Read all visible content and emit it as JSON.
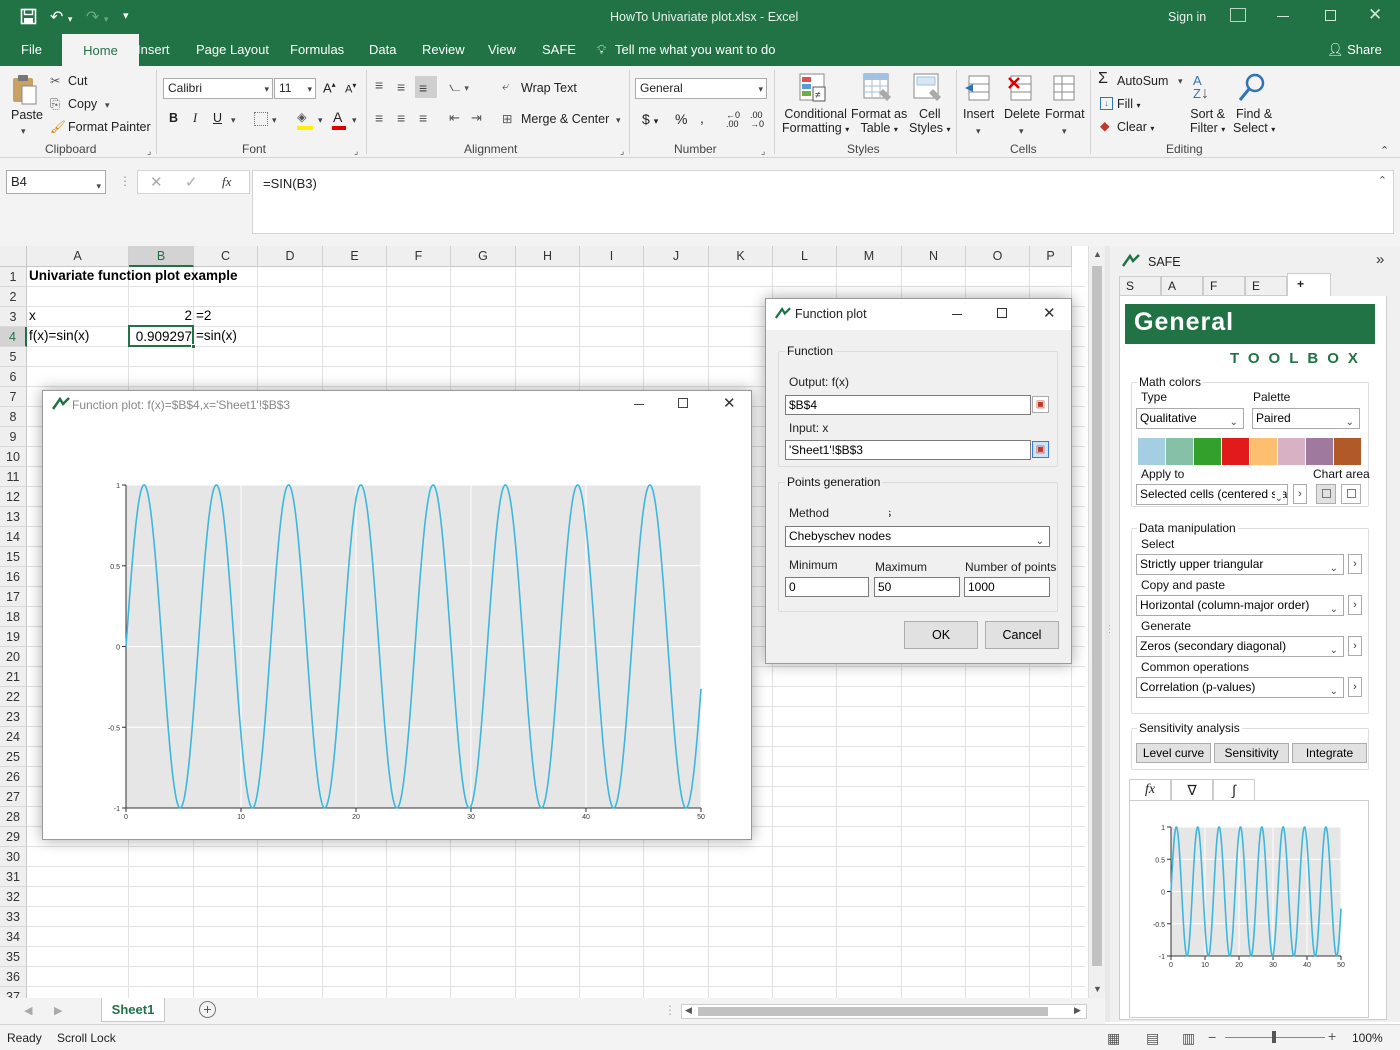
{
  "window": {
    "title": "HowTo Univariate plot.xlsx - Excel",
    "sign_in": "Sign in"
  },
  "tabs": [
    "File",
    "Home",
    "Insert",
    "Page Layout",
    "Formulas",
    "Data",
    "Review",
    "View",
    "SAFE"
  ],
  "tell_me": "Tell me what you want to do",
  "share": "Share",
  "ribbon": {
    "paste": "Paste",
    "cut": "Cut",
    "copy": "Copy",
    "format_painter": "Format Painter",
    "clipboard": "Clipboard",
    "font_name": "Calibri",
    "font_size": "11",
    "font": "Font",
    "wrap_text": "Wrap Text",
    "merge_center": "Merge & Center",
    "alignment": "Alignment",
    "number_format": "General",
    "number": "Number",
    "conditional_formatting": [
      "Conditional",
      "Formatting"
    ],
    "format_as_table": [
      "Format as",
      "Table"
    ],
    "cell_styles": [
      "Cell",
      "Styles"
    ],
    "styles": "Styles",
    "insert": "Insert",
    "delete": "Delete",
    "format": "Format",
    "cells": "Cells",
    "autosum": "AutoSum",
    "fill": "Fill",
    "clear": "Clear",
    "sort_filter": [
      "Sort &",
      "Filter"
    ],
    "find_select": [
      "Find &",
      "Select"
    ],
    "editing": "Editing"
  },
  "formula_bar": {
    "name_box": "B4",
    "formula": "=SIN(B3)",
    "fx": "fx"
  },
  "columns": [
    "A",
    "B",
    "C",
    "D",
    "E",
    "F",
    "G",
    "H",
    "I",
    "J",
    "K",
    "L",
    "M",
    "N",
    "O",
    "P"
  ],
  "rows": [
    "1",
    "2",
    "3",
    "4",
    "5",
    "6",
    "7",
    "8",
    "9",
    "10",
    "11",
    "12",
    "13",
    "14",
    "15",
    "16",
    "17",
    "18",
    "19",
    "20",
    "21",
    "22",
    "23",
    "24",
    "25",
    "26",
    "27",
    "28",
    "29",
    "30",
    "31",
    "32",
    "33",
    "34",
    "35",
    "36",
    "37"
  ],
  "cells": {
    "a1": "Univariate function plot example",
    "a3": "x",
    "b3": "2",
    "c3": "=2",
    "a4": "f(x)=sin(x)",
    "b4": "0.909297",
    "c4": "=sin(x)"
  },
  "plot_window": {
    "title": "Function plot: f(x)=$B$4,x='Sheet1'!$B$3"
  },
  "chart_data": [
    {
      "type": "line",
      "function": "sin(x)",
      "xlim": [
        0,
        50
      ],
      "ylim": [
        -1,
        1
      ],
      "xticks": [
        "0",
        "10",
        "20",
        "30",
        "40",
        "50"
      ],
      "yticks": [
        "1",
        "0.5",
        "0",
        "-0.5",
        "-1"
      ],
      "grid": true
    },
    {
      "type": "line",
      "function": "sin(x)",
      "xlim": [
        0,
        50
      ],
      "ylim": [
        -1,
        1
      ],
      "xticks": [
        "0",
        "10",
        "20",
        "30",
        "40",
        "50"
      ],
      "yticks": [
        "1",
        "0.5",
        "0",
        "-0.5",
        "-1"
      ],
      "grid": true
    }
  ],
  "dialog": {
    "title": "Function plot",
    "function_group": "Function",
    "output_label": "Output: f(x)",
    "output_value": "$B$4",
    "input_label": "Input: x",
    "input_value": "'Sheet1'!$B$3",
    "points_group": "Points generation",
    "method_label": "Method",
    "method_value": "Chebyschev nodes",
    "min_label": "Minimum",
    "min_value": "0",
    "max_label": "Maximum",
    "max_value": "50",
    "npoints_label": "Number of points",
    "npoints_value": "1000",
    "ok": "OK",
    "cancel": "Cancel"
  },
  "safe_pane": {
    "title": "SAFE",
    "tabs": [
      "S",
      "A",
      "F",
      "E",
      "+"
    ],
    "banner": "General",
    "toolbox": "TOOLBOX",
    "math_colors": "Math colors",
    "type_label": "Type",
    "type_value": "Qualitative",
    "palette_label": "Palette",
    "palette_value": "Paired",
    "swatch_colors": [
      "#a6cee3",
      "#86c0a7",
      "#33a02c",
      "#e31a1c",
      "#fdbf6f",
      "#d8b1c4",
      "#9f7a9e",
      "#b15928"
    ],
    "apply_to": "Apply to",
    "chart_area": "Chart area",
    "apply_value": "Selected cells (centered sta",
    "data_manip": "Data manipulation",
    "select_label": "Select",
    "select_value": "Strictly upper triangular",
    "copy_label": "Copy and paste",
    "copy_value": "Horizontal (column-major order)",
    "generate_label": "Generate",
    "generate_value": "Zeros (secondary diagonal)",
    "common_label": "Common operations",
    "common_value": "Correlation (p-values)",
    "sensitivity": "Sensitivity analysis",
    "level_curve": "Level curve",
    "sensitivity_btn": "Sensitivity",
    "integrate": "Integrate",
    "bottom_tabs": [
      "fx",
      "∇",
      "∫"
    ]
  },
  "sheet_tab": "Sheet1",
  "status": {
    "ready": "Ready",
    "scroll_lock": "Scroll Lock",
    "zoom": "100%"
  },
  "colors": {
    "excel_green": "#217346",
    "curve": "#3cb8dc",
    "plot_bg": "#e6e6e6"
  }
}
